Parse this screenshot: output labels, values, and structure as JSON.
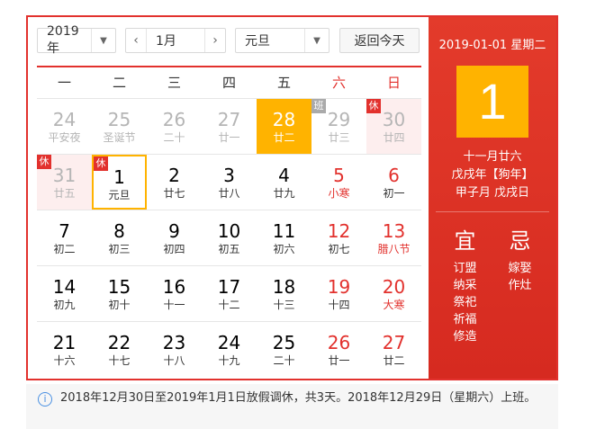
{
  "toolbar": {
    "year": "2019年",
    "month": "1月",
    "prev_icon": "‹",
    "next_icon": "›",
    "holiday": "元旦",
    "today_label": "返回今天"
  },
  "weekdays": [
    "一",
    "二",
    "三",
    "四",
    "五",
    "六",
    "日"
  ],
  "weeks": [
    [
      {
        "day": "24",
        "sub": "平安夜",
        "kind": "other"
      },
      {
        "day": "25",
        "sub": "圣诞节",
        "kind": "other"
      },
      {
        "day": "26",
        "sub": "二十",
        "kind": "other"
      },
      {
        "day": "27",
        "sub": "廿一",
        "kind": "other"
      },
      {
        "day": "28",
        "sub": "廿二",
        "kind": "selected"
      },
      {
        "day": "29",
        "sub": "廿三",
        "kind": "other",
        "badge": "班"
      },
      {
        "day": "30",
        "sub": "廿四",
        "kind": "other",
        "badge": "休",
        "hol": true
      }
    ],
    [
      {
        "day": "31",
        "sub": "廿五",
        "kind": "other",
        "badge": "休",
        "hol": true
      },
      {
        "day": "1",
        "sub": "元旦",
        "kind": "today",
        "badge": "休"
      },
      {
        "day": "2",
        "sub": "廿七"
      },
      {
        "day": "3",
        "sub": "廿八"
      },
      {
        "day": "4",
        "sub": "廿九"
      },
      {
        "day": "5",
        "sub": "小寒",
        "kind": "red"
      },
      {
        "day": "6",
        "sub": "初一",
        "kind": "weekend"
      }
    ],
    [
      {
        "day": "7",
        "sub": "初二"
      },
      {
        "day": "8",
        "sub": "初三"
      },
      {
        "day": "9",
        "sub": "初四"
      },
      {
        "day": "10",
        "sub": "初五"
      },
      {
        "day": "11",
        "sub": "初六"
      },
      {
        "day": "12",
        "sub": "初七",
        "kind": "weekend"
      },
      {
        "day": "13",
        "sub": "腊八节",
        "kind": "red"
      }
    ],
    [
      {
        "day": "14",
        "sub": "初九"
      },
      {
        "day": "15",
        "sub": "初十"
      },
      {
        "day": "16",
        "sub": "十一"
      },
      {
        "day": "17",
        "sub": "十二"
      },
      {
        "day": "18",
        "sub": "十三"
      },
      {
        "day": "19",
        "sub": "十四",
        "kind": "weekend"
      },
      {
        "day": "20",
        "sub": "大寒",
        "kind": "red"
      }
    ],
    [
      {
        "day": "21",
        "sub": "十六"
      },
      {
        "day": "22",
        "sub": "十七"
      },
      {
        "day": "23",
        "sub": "十八"
      },
      {
        "day": "24",
        "sub": "十九"
      },
      {
        "day": "25",
        "sub": "二十"
      },
      {
        "day": "26",
        "sub": "廿一",
        "kind": "weekend"
      },
      {
        "day": "27",
        "sub": "廿二",
        "kind": "weekend"
      }
    ]
  ],
  "side": {
    "date_line": "2019-01-01 星期二",
    "big_day": "1",
    "lunar_lines": [
      "十一月廿六",
      "戊戌年【狗年】",
      "甲子月 戊戌日"
    ],
    "yi_label": "宜",
    "ji_label": "忌",
    "yi_items": [
      "订盟",
      "纳采",
      "祭祀",
      "祈福",
      "修造"
    ],
    "ji_items": [
      "嫁娶",
      "作灶"
    ]
  },
  "notice": {
    "icon": "info-icon",
    "text": "2018年12月30日至2019年1月1日放假调休，共3天。2018年12月29日（星期六）上班。"
  },
  "colors": {
    "accent": "#e2312d",
    "highlight": "#ffb300"
  }
}
